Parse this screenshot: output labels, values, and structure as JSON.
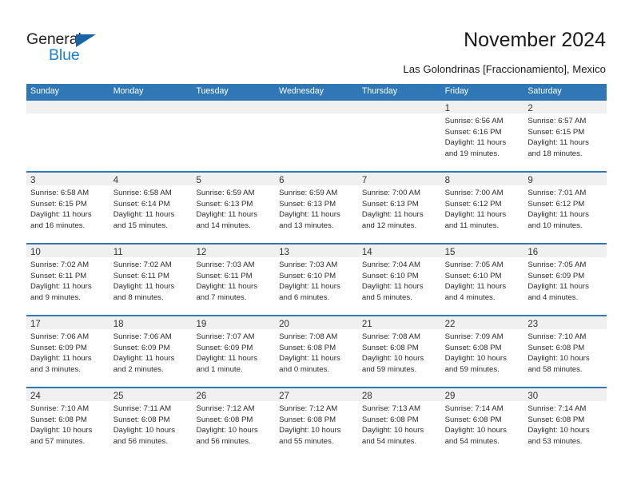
{
  "brand": {
    "name_part1": "General",
    "name_part2": "Blue",
    "triangle_icon": "triangle-icon",
    "accent_dark": "#1565a8",
    "accent_blue": "#1b7fd4"
  },
  "header": {
    "month_title": "November 2024",
    "location": "Las Golondrinas [Fraccionamiento], Mexico"
  },
  "theme": {
    "header_band": "#3077b6",
    "day_band": "#f0f0f0",
    "text": "#2b2b2b"
  },
  "calendar": {
    "weekday_headers": [
      "Sunday",
      "Monday",
      "Tuesday",
      "Wednesday",
      "Thursday",
      "Friday",
      "Saturday"
    ],
    "weeks": [
      [
        {
          "day": "",
          "lines": []
        },
        {
          "day": "",
          "lines": []
        },
        {
          "day": "",
          "lines": []
        },
        {
          "day": "",
          "lines": []
        },
        {
          "day": "",
          "lines": []
        },
        {
          "day": "1",
          "lines": [
            "Sunrise: 6:56 AM",
            "Sunset: 6:16 PM",
            "Daylight: 11 hours",
            "and 19 minutes."
          ]
        },
        {
          "day": "2",
          "lines": [
            "Sunrise: 6:57 AM",
            "Sunset: 6:15 PM",
            "Daylight: 11 hours",
            "and 18 minutes."
          ]
        }
      ],
      [
        {
          "day": "3",
          "lines": [
            "Sunrise: 6:58 AM",
            "Sunset: 6:15 PM",
            "Daylight: 11 hours",
            "and 16 minutes."
          ]
        },
        {
          "day": "4",
          "lines": [
            "Sunrise: 6:58 AM",
            "Sunset: 6:14 PM",
            "Daylight: 11 hours",
            "and 15 minutes."
          ]
        },
        {
          "day": "5",
          "lines": [
            "Sunrise: 6:59 AM",
            "Sunset: 6:13 PM",
            "Daylight: 11 hours",
            "and 14 minutes."
          ]
        },
        {
          "day": "6",
          "lines": [
            "Sunrise: 6:59 AM",
            "Sunset: 6:13 PM",
            "Daylight: 11 hours",
            "and 13 minutes."
          ]
        },
        {
          "day": "7",
          "lines": [
            "Sunrise: 7:00 AM",
            "Sunset: 6:13 PM",
            "Daylight: 11 hours",
            "and 12 minutes."
          ]
        },
        {
          "day": "8",
          "lines": [
            "Sunrise: 7:00 AM",
            "Sunset: 6:12 PM",
            "Daylight: 11 hours",
            "and 11 minutes."
          ]
        },
        {
          "day": "9",
          "lines": [
            "Sunrise: 7:01 AM",
            "Sunset: 6:12 PM",
            "Daylight: 11 hours",
            "and 10 minutes."
          ]
        }
      ],
      [
        {
          "day": "10",
          "lines": [
            "Sunrise: 7:02 AM",
            "Sunset: 6:11 PM",
            "Daylight: 11 hours",
            "and 9 minutes."
          ]
        },
        {
          "day": "11",
          "lines": [
            "Sunrise: 7:02 AM",
            "Sunset: 6:11 PM",
            "Daylight: 11 hours",
            "and 8 minutes."
          ]
        },
        {
          "day": "12",
          "lines": [
            "Sunrise: 7:03 AM",
            "Sunset: 6:11 PM",
            "Daylight: 11 hours",
            "and 7 minutes."
          ]
        },
        {
          "day": "13",
          "lines": [
            "Sunrise: 7:03 AM",
            "Sunset: 6:10 PM",
            "Daylight: 11 hours",
            "and 6 minutes."
          ]
        },
        {
          "day": "14",
          "lines": [
            "Sunrise: 7:04 AM",
            "Sunset: 6:10 PM",
            "Daylight: 11 hours",
            "and 5 minutes."
          ]
        },
        {
          "day": "15",
          "lines": [
            "Sunrise: 7:05 AM",
            "Sunset: 6:10 PM",
            "Daylight: 11 hours",
            "and 4 minutes."
          ]
        },
        {
          "day": "16",
          "lines": [
            "Sunrise: 7:05 AM",
            "Sunset: 6:09 PM",
            "Daylight: 11 hours",
            "and 4 minutes."
          ]
        }
      ],
      [
        {
          "day": "17",
          "lines": [
            "Sunrise: 7:06 AM",
            "Sunset: 6:09 PM",
            "Daylight: 11 hours",
            "and 3 minutes."
          ]
        },
        {
          "day": "18",
          "lines": [
            "Sunrise: 7:06 AM",
            "Sunset: 6:09 PM",
            "Daylight: 11 hours",
            "and 2 minutes."
          ]
        },
        {
          "day": "19",
          "lines": [
            "Sunrise: 7:07 AM",
            "Sunset: 6:09 PM",
            "Daylight: 11 hours",
            "and 1 minute."
          ]
        },
        {
          "day": "20",
          "lines": [
            "Sunrise: 7:08 AM",
            "Sunset: 6:08 PM",
            "Daylight: 11 hours",
            "and 0 minutes."
          ]
        },
        {
          "day": "21",
          "lines": [
            "Sunrise: 7:08 AM",
            "Sunset: 6:08 PM",
            "Daylight: 10 hours",
            "and 59 minutes."
          ]
        },
        {
          "day": "22",
          "lines": [
            "Sunrise: 7:09 AM",
            "Sunset: 6:08 PM",
            "Daylight: 10 hours",
            "and 59 minutes."
          ]
        },
        {
          "day": "23",
          "lines": [
            "Sunrise: 7:10 AM",
            "Sunset: 6:08 PM",
            "Daylight: 10 hours",
            "and 58 minutes."
          ]
        }
      ],
      [
        {
          "day": "24",
          "lines": [
            "Sunrise: 7:10 AM",
            "Sunset: 6:08 PM",
            "Daylight: 10 hours",
            "and 57 minutes."
          ]
        },
        {
          "day": "25",
          "lines": [
            "Sunrise: 7:11 AM",
            "Sunset: 6:08 PM",
            "Daylight: 10 hours",
            "and 56 minutes."
          ]
        },
        {
          "day": "26",
          "lines": [
            "Sunrise: 7:12 AM",
            "Sunset: 6:08 PM",
            "Daylight: 10 hours",
            "and 56 minutes."
          ]
        },
        {
          "day": "27",
          "lines": [
            "Sunrise: 7:12 AM",
            "Sunset: 6:08 PM",
            "Daylight: 10 hours",
            "and 55 minutes."
          ]
        },
        {
          "day": "28",
          "lines": [
            "Sunrise: 7:13 AM",
            "Sunset: 6:08 PM",
            "Daylight: 10 hours",
            "and 54 minutes."
          ]
        },
        {
          "day": "29",
          "lines": [
            "Sunrise: 7:14 AM",
            "Sunset: 6:08 PM",
            "Daylight: 10 hours",
            "and 54 minutes."
          ]
        },
        {
          "day": "30",
          "lines": [
            "Sunrise: 7:14 AM",
            "Sunset: 6:08 PM",
            "Daylight: 10 hours",
            "and 53 minutes."
          ]
        }
      ]
    ]
  }
}
